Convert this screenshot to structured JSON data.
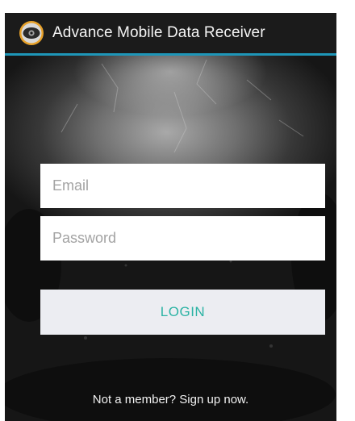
{
  "action_bar": {
    "icon": "eye-icon",
    "title": "Advance Mobile Data Receiver",
    "accent_color": "#1e96b8"
  },
  "form": {
    "email_placeholder": "Email",
    "password_placeholder": "Password",
    "login_label": "LOGIN",
    "login_text_color": "#2bb3a4"
  },
  "footer": {
    "signup_text": "Not a member? Sign up now."
  }
}
